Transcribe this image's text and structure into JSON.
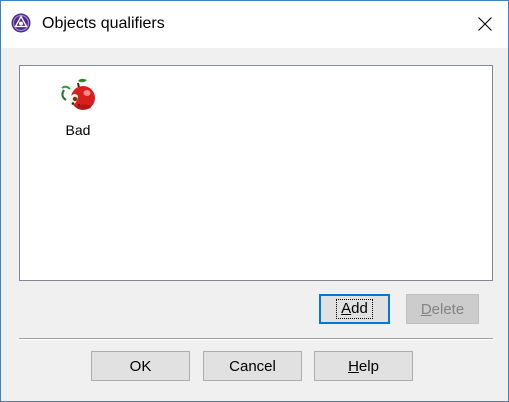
{
  "window": {
    "title": "Objects qualifiers",
    "app_icon": "app-logo-icon",
    "close_icon": "close-icon"
  },
  "list": {
    "items": [
      {
        "label": "Bad",
        "icon": "rotten-apple-icon"
      }
    ]
  },
  "buttons": {
    "add": {
      "mnemonic": "A",
      "rest": "dd"
    },
    "delete": {
      "mnemonic": "D",
      "rest": "elete",
      "disabled": true
    },
    "ok": "OK",
    "cancel": "Cancel",
    "help": {
      "mnemonic": "H",
      "rest": "elp"
    }
  }
}
